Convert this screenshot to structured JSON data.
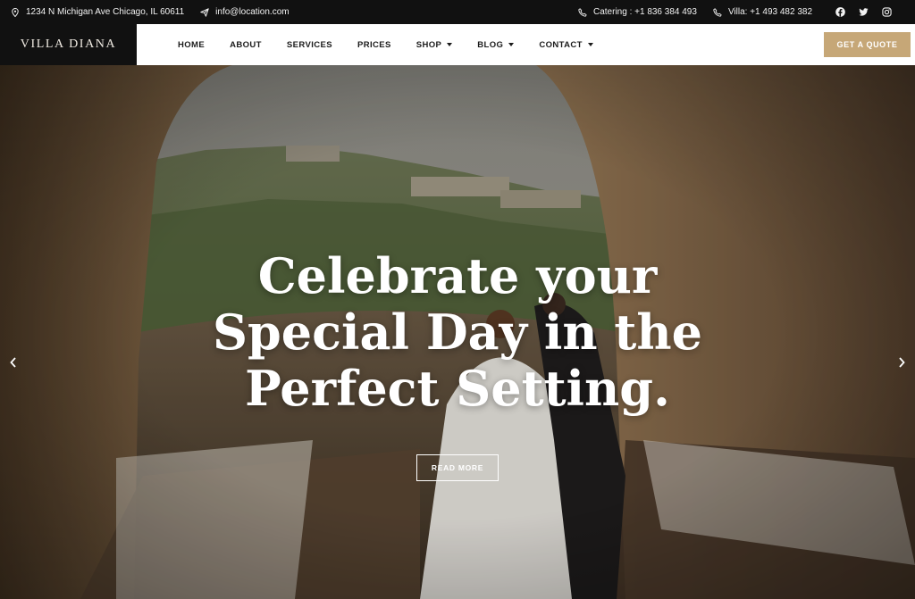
{
  "topbar": {
    "address": "1234 N Michigan Ave Chicago, IL 60611",
    "email": "info@location.com",
    "catering": "Catering : +1 836 384 493",
    "villa": "Villa: +1 493 482 382",
    "social_icons": [
      "facebook-icon",
      "twitter-icon",
      "instagram-icon"
    ]
  },
  "header": {
    "logo": "VILLA DIANA",
    "nav": [
      {
        "label": "HOME",
        "dropdown": false
      },
      {
        "label": "ABOUT",
        "dropdown": false
      },
      {
        "label": "SERVICES",
        "dropdown": false
      },
      {
        "label": "PRICES",
        "dropdown": false
      },
      {
        "label": "SHOP",
        "dropdown": true
      },
      {
        "label": "BLOG",
        "dropdown": true
      },
      {
        "label": "CONTACT",
        "dropdown": true
      }
    ],
    "cta": "GET A QUOTE"
  },
  "hero": {
    "title_lines": [
      "Celebrate your",
      "Special Day in the",
      "Perfect Setting."
    ],
    "button": "READ MORE"
  },
  "colors": {
    "topbar_bg": "#111111",
    "accent": "#c6a777",
    "header_bg": "#ffffff"
  }
}
